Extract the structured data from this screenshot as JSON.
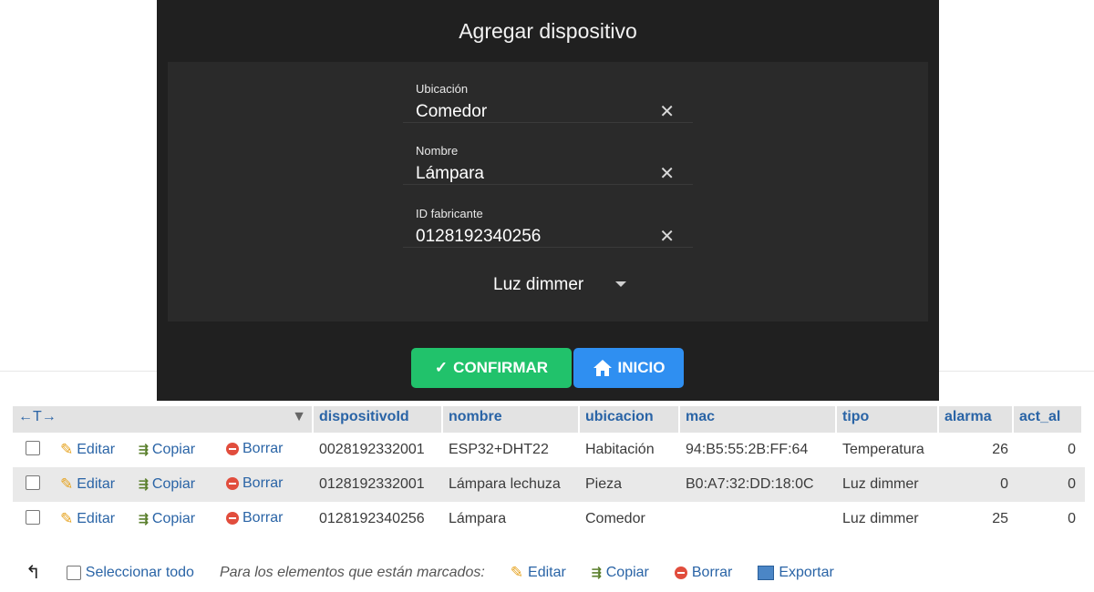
{
  "modal": {
    "title": "Agregar dispositivo",
    "fields": [
      {
        "label": "Ubicación",
        "value": "Comedor"
      },
      {
        "label": "Nombre",
        "value": "Lámpara"
      },
      {
        "label": "ID fabricante",
        "value": "0128192340256"
      }
    ],
    "clear_glyph": "✕",
    "type_select": {
      "selected": "Luz dimmer"
    },
    "confirm_label": "CONFIRMAR",
    "home_label": "INICIO"
  },
  "table": {
    "arrows": "←T→",
    "columns": [
      "dispositivoId",
      "nombre",
      "ubicacion",
      "mac",
      "tipo",
      "alarma",
      "act_al"
    ],
    "actions": {
      "edit": "Editar",
      "copy": "Copiar",
      "delete": "Borrar"
    },
    "rows": [
      {
        "dispositivoId": "0028192332001",
        "nombre": "ESP32+DHT22",
        "ubicacion": "Habitación",
        "mac": "94:B5:55:2B:FF:64",
        "tipo": "Temperatura",
        "alarma": "26",
        "act_al": "0"
      },
      {
        "dispositivoId": "0128192332001",
        "nombre": "Lámpara lechuza",
        "ubicacion": "Pieza",
        "mac": "B0:A7:32:DD:18:0C",
        "tipo": "Luz dimmer",
        "alarma": "0",
        "act_al": "0"
      },
      {
        "dispositivoId": "0128192340256",
        "nombre": "Lámpara",
        "ubicacion": "Comedor",
        "mac": "",
        "tipo": "Luz dimmer",
        "alarma": "25",
        "act_al": "0"
      }
    ]
  },
  "footer": {
    "select_all": "Seleccionar todo",
    "marked_note": "Para los elementos que están marcados:",
    "edit": "Editar",
    "copy": "Copiar",
    "delete": "Borrar",
    "export": "Exportar"
  }
}
